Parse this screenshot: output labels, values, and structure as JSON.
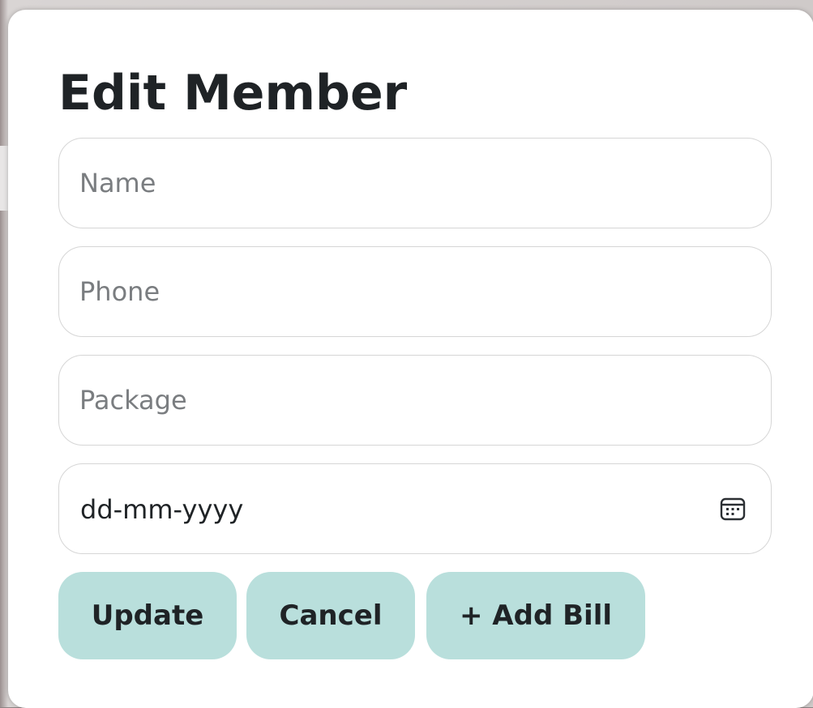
{
  "dialog": {
    "title": "Edit Member",
    "fields": {
      "name": {
        "placeholder": "Name",
        "value": ""
      },
      "phone": {
        "placeholder": "Phone",
        "value": ""
      },
      "package": {
        "placeholder": "Package",
        "value": ""
      },
      "date": {
        "display": "dd-mm-yyyy",
        "icon": "calendar-icon"
      }
    },
    "buttons": {
      "update": "Update",
      "cancel": "Cancel",
      "add_bill": "+ Add Bill"
    }
  },
  "colors": {
    "button_bg": "#b9dfdc",
    "text": "#1f2326",
    "placeholder": "#7a7d80",
    "border": "#d6d6d6"
  }
}
